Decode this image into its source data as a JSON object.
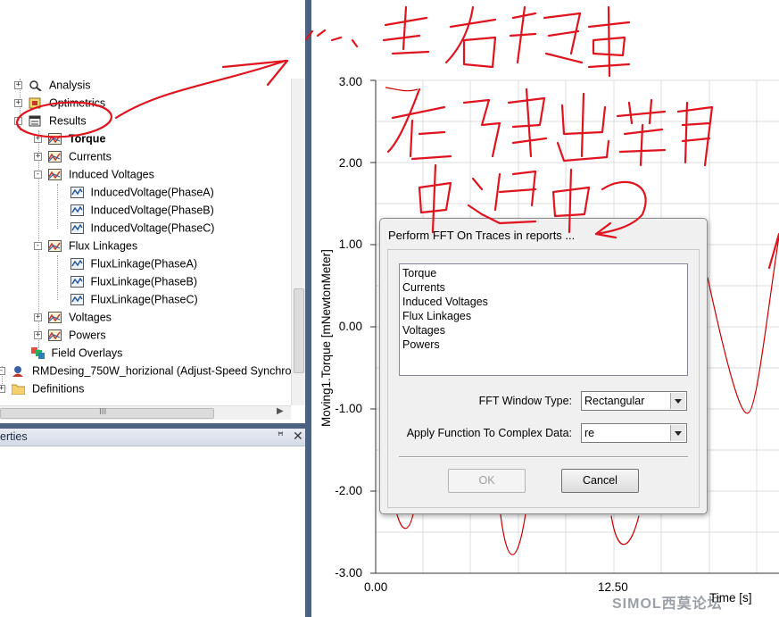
{
  "tree": {
    "items": [
      {
        "label": "Analysis",
        "expander": "+"
      },
      {
        "label": "Optimetrics",
        "expander": "+"
      },
      {
        "label": "Results",
        "expander": "-"
      },
      {
        "label": "Torque",
        "expander": "+"
      },
      {
        "label": "Currents",
        "expander": "+"
      },
      {
        "label": "Induced Voltages",
        "expander": "-"
      },
      {
        "label": "InducedVoltage(PhaseA)"
      },
      {
        "label": "InducedVoltage(PhaseB)"
      },
      {
        "label": "InducedVoltage(PhaseC)"
      },
      {
        "label": "Flux Linkages",
        "expander": "-"
      },
      {
        "label": "FluxLinkage(PhaseA)"
      },
      {
        "label": "FluxLinkage(PhaseB)"
      },
      {
        "label": "FluxLinkage(PhaseC)"
      },
      {
        "label": "Voltages",
        "expander": "+"
      },
      {
        "label": "Powers",
        "expander": "+"
      },
      {
        "label": "Field Overlays"
      },
      {
        "label": "RMDesing_750W_horizional (Adjust-Speed Synchro",
        "expander": "-"
      },
      {
        "label": "Definitions",
        "expander": "+"
      }
    ],
    "hscroll_grip": "III"
  },
  "properties": {
    "title": "erties",
    "pin": "ꟸ",
    "close": "✕"
  },
  "plot": {
    "y_ticks": [
      "3.00",
      "2.00",
      "1.00",
      "0.00",
      "-1.00",
      "-2.00",
      "-3.00"
    ],
    "x_ticks": [
      "0.00",
      "12.50"
    ],
    "ylabel": "Moving1.Torque [mNewtonMeter]",
    "xlabel": "Time [s]",
    "watermark": "SIMOL西莫论坛",
    "curve_color": "#cc0000"
  },
  "chart_data": {
    "type": "line",
    "title": "",
    "xlabel": "Time [s]",
    "ylabel": "Moving1.Torque [mNewtonMeter]",
    "ylim": [
      -3.0,
      3.0
    ],
    "x_ticks": [
      0.0,
      12.5
    ],
    "y_ticks": [
      -3.0,
      -2.0,
      -1.0,
      0.0,
      1.0,
      2.0,
      3.0
    ],
    "grid": true,
    "series": [
      {
        "values_visible_minima": [
          -2.5,
          -2.9,
          -2.7
        ],
        "values_visible_min_right": -1.05
      }
    ]
  },
  "dialog": {
    "title": "Perform FFT On Traces in reports ...",
    "list_items": [
      "Torque",
      "Currents",
      "Induced Voltages",
      "Flux Linkages",
      "Voltages",
      "Powers"
    ],
    "window_type_label": "FFT Window Type:",
    "window_type_value": "Rectangular",
    "complex_label": "Apply Function To Complex Data:",
    "complex_value": "re",
    "ok_label": "OK",
    "cancel_label": "Cancel"
  },
  "annotation": {
    "color": "#e0141e",
    "text_line1": "点击右键",
    "text_line2": "在弹出菜单",
    "text_line3": "中选中"
  }
}
